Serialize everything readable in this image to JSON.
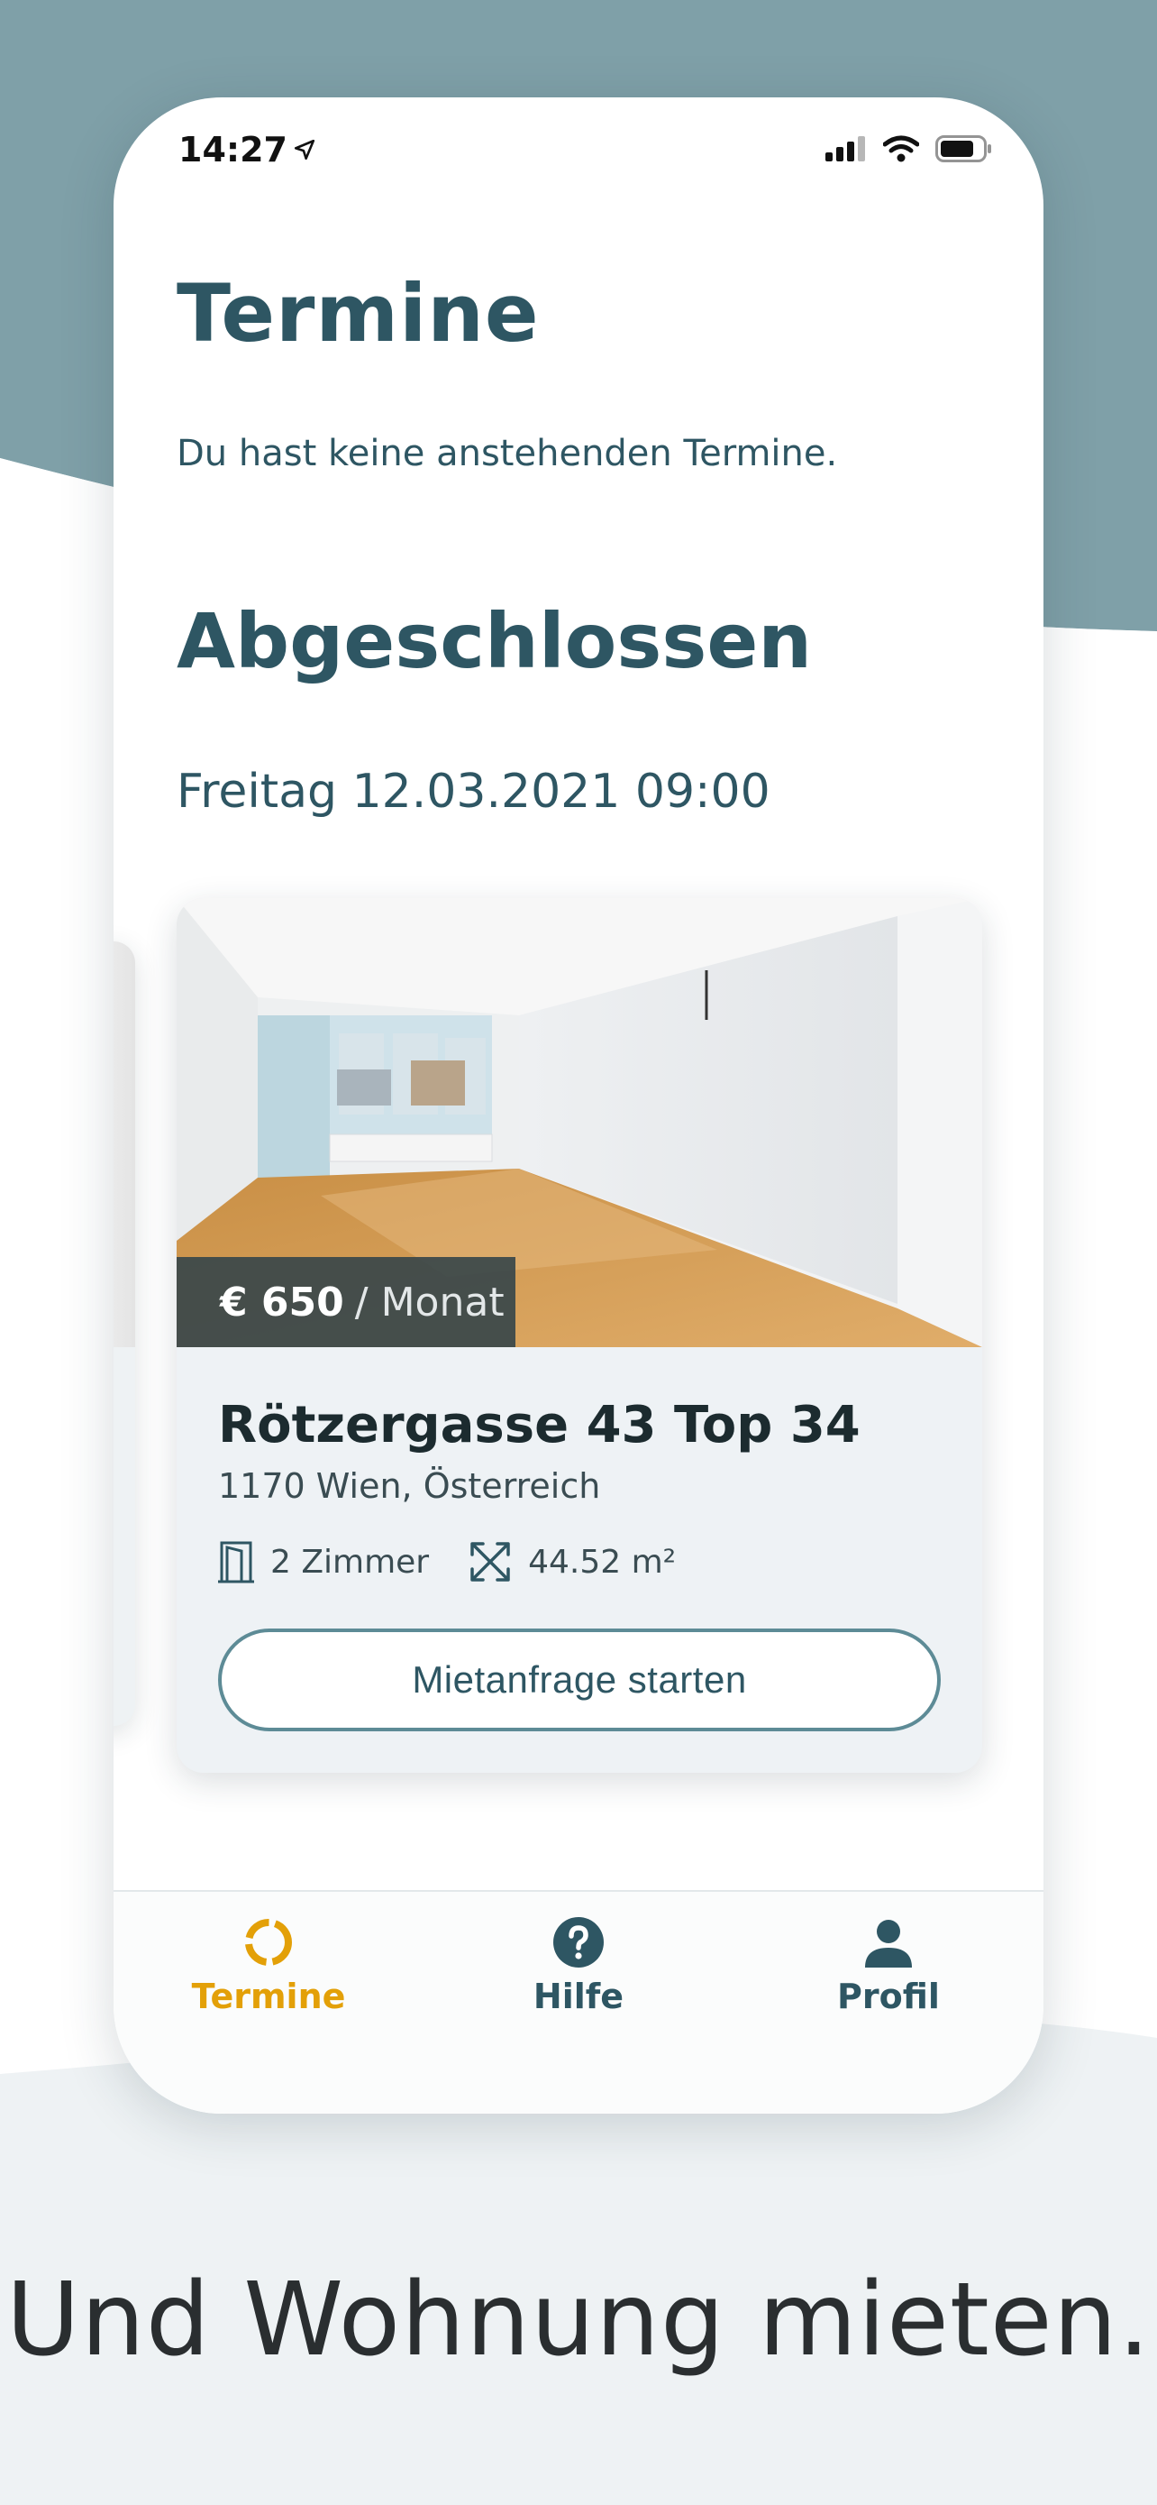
{
  "status_bar": {
    "time": "14:27"
  },
  "screen": {
    "title": "Termine",
    "empty_message": "Du hast keine anstehenden Termine.",
    "completed_heading": "Abgeschlossen",
    "appointment_datetime": "Freitag 12.03.2021 09:00"
  },
  "listing": {
    "price": "€ 650",
    "price_unit": "/ Monat",
    "address": "Rötzergasse 43 Top 34",
    "city": "1170 Wien, Österreich",
    "rooms": "2 Zimmer",
    "area": "44.52 m²",
    "cta_label": "Mietanfrage starten"
  },
  "tabbar": {
    "items": [
      {
        "label": "Termine",
        "icon": "appointments-icon",
        "active": true
      },
      {
        "label": "Hilfe",
        "icon": "help-icon",
        "active": false
      },
      {
        "label": "Profil",
        "icon": "profile-icon",
        "active": false
      }
    ]
  },
  "tagline": "Und Wohnung mieten.",
  "colors": {
    "brand_teal": "#2e5663",
    "accent_yellow": "#e3a008",
    "backdrop_teal": "#7fa0a8",
    "backdrop_light": "#eef2f4"
  }
}
